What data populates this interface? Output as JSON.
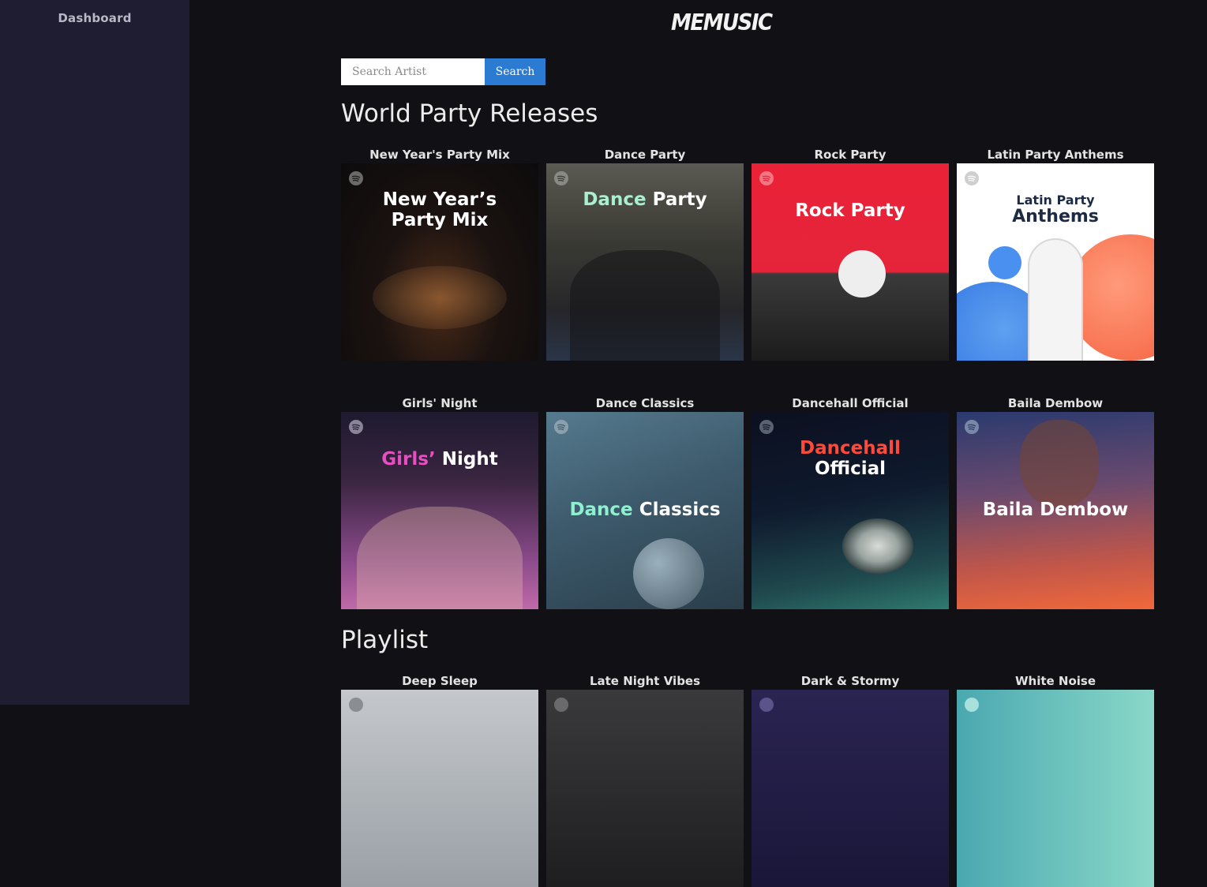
{
  "sidebar": {
    "items": [
      {
        "label": "Dashboard"
      }
    ]
  },
  "header": {
    "logo": "MEMUSIC"
  },
  "search": {
    "placeholder": "Search Artist",
    "value": "",
    "button_label": "Search"
  },
  "sections": [
    {
      "title": "World Party Releases",
      "cards": [
        {
          "title": "New Year's Party Mix",
          "cover_lines": [
            "New Year’s",
            "Party Mix"
          ],
          "colors": {
            "bg": "#0f0e0d",
            "text": "#ffffff"
          }
        },
        {
          "title": "Dance Party",
          "cover_parts": [
            "Dance",
            "Party"
          ],
          "colors": {
            "bg": "#3a3a36",
            "accent": "#a8f0d0",
            "text": "#ffffff"
          }
        },
        {
          "title": "Rock Party",
          "cover_lines": [
            "Rock Party"
          ],
          "colors": {
            "bg": "#e8253a",
            "text": "#ffffff"
          }
        },
        {
          "title": "Latin Party Anthems",
          "cover_lines": [
            "Latin Party",
            "Anthems"
          ],
          "colors": {
            "bg": "#ffffff",
            "text": "#1d2a44"
          }
        }
      ]
    },
    {
      "title": "",
      "cards": [
        {
          "title": "Girls' Night",
          "cover_parts": [
            "Girls’",
            "Night"
          ],
          "colors": {
            "bg": "#5a2f5e",
            "accent": "#e64fc0",
            "text": "#ffffff"
          }
        },
        {
          "title": "Dance Classics",
          "cover_parts": [
            "Dance",
            "Classics"
          ],
          "colors": {
            "bg": "#3d5a6c",
            "accent": "#8ff0d0",
            "text": "#ffffff"
          }
        },
        {
          "title": "Dancehall Official",
          "cover_lines": [
            "Dancehall",
            "Official"
          ],
          "colors": {
            "bg": "#0f1a2e",
            "accent": "#ff4a3a",
            "text": "#ffffff"
          }
        },
        {
          "title": "Baila Dembow",
          "cover_lines": [
            "Baila Dembow"
          ],
          "colors": {
            "bg": "#b9554c",
            "text": "#ffffff"
          }
        }
      ]
    },
    {
      "title": "Playlist",
      "cards": [
        {
          "title": "Deep Sleep",
          "colors": {
            "bg": "#b7bcc2"
          }
        },
        {
          "title": "Late Night Vibes",
          "colors": {
            "bg": "#2d2d2f"
          }
        },
        {
          "title": "Dark & Stormy",
          "colors": {
            "bg": "#2a2452"
          }
        },
        {
          "title": "White Noise",
          "colors": {
            "bg": "#5bb5b3"
          }
        }
      ]
    }
  ]
}
